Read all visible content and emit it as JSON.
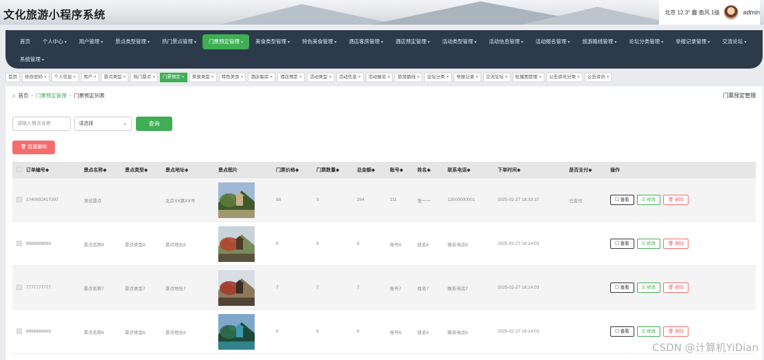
{
  "app": {
    "title": "文化旅游小程序系统"
  },
  "header": {
    "weather": "北京  12.3°  霾  南风  1级",
    "username": "admin"
  },
  "nav": {
    "items": [
      {
        "label": "首页",
        "has_caret": false
      },
      {
        "label": "个人中心",
        "has_caret": true
      },
      {
        "label": "用户管理",
        "has_caret": true
      },
      {
        "label": "景点类型管理",
        "has_caret": true
      },
      {
        "label": "热门景点管理",
        "has_caret": true
      },
      {
        "label": "门票预定管理",
        "has_caret": true,
        "active": true
      },
      {
        "label": "美食类型管理",
        "has_caret": true
      },
      {
        "label": "特色美食管理",
        "has_caret": true
      },
      {
        "label": "酒店客房管理",
        "has_caret": true
      },
      {
        "label": "酒店预定管理",
        "has_caret": true
      },
      {
        "label": "活动类型管理",
        "has_caret": true
      },
      {
        "label": "活动信息管理",
        "has_caret": true
      },
      {
        "label": "活动报名管理",
        "has_caret": true
      },
      {
        "label": "旅游路线管理",
        "has_caret": true
      },
      {
        "label": "论坛分类管理",
        "has_caret": true
      },
      {
        "label": "举报记录管理",
        "has_caret": true
      },
      {
        "label": "交流论坛",
        "has_caret": true
      },
      {
        "label": "系统管理",
        "has_caret": true
      }
    ],
    "caret": "▾"
  },
  "tags": [
    {
      "label": "首页",
      "closable": false
    },
    {
      "label": "修改密码",
      "closable": true
    },
    {
      "label": "个人信息",
      "closable": true
    },
    {
      "label": "用户",
      "closable": true
    },
    {
      "label": "景点类型",
      "closable": true
    },
    {
      "label": "热门景点",
      "closable": true
    },
    {
      "label": "门票预定",
      "closable": true,
      "active": true
    },
    {
      "label": "美食类型",
      "closable": true
    },
    {
      "label": "特色美食",
      "closable": true
    },
    {
      "label": "酒店客房",
      "closable": true
    },
    {
      "label": "酒店预定",
      "closable": true
    },
    {
      "label": "活动类型",
      "closable": true
    },
    {
      "label": "活动信息",
      "closable": true
    },
    {
      "label": "活动报名",
      "closable": true
    },
    {
      "label": "旅游路线",
      "closable": true
    },
    {
      "label": "论坛分类",
      "closable": true
    },
    {
      "label": "举报记录",
      "closable": true
    },
    {
      "label": "交流论坛",
      "closable": true
    },
    {
      "label": "轮播图管理",
      "closable": true
    },
    {
      "label": "公告资讯分类",
      "closable": true
    },
    {
      "label": "公告资讯",
      "closable": true
    }
  ],
  "breadcrumb": {
    "home": "首页",
    "sep": "-",
    "module": "门票预定管理",
    "current": "门票预定列表"
  },
  "page_label": "门票预定管理",
  "search": {
    "placeholder": "请输入景点名称",
    "select_value": "请选择",
    "query_label": "查询",
    "batch_delete_label": "批量删除"
  },
  "table": {
    "headers": [
      "订单编号",
      "景点名称",
      "景点类型",
      "景点地址",
      "景点图片",
      "门票价格",
      "门票数量",
      "总金额",
      "账号",
      "姓名",
      "联系电话",
      "下单时间",
      "是否支付",
      "操作"
    ],
    "sort_mark": "◆",
    "actions": {
      "view": "查看",
      "edit": "修改",
      "delete": "删除"
    },
    "rows": [
      {
        "order_no": "1740652417397",
        "name": "测试景点",
        "type": "",
        "address": "北京XX路XX号",
        "price": "88",
        "qty": "3",
        "total": "264",
        "account": "111",
        "person": "张一一",
        "phone": "13500000001",
        "time": "2025-02-27 18:33:37",
        "paid": "已支付",
        "img": "scene-1"
      },
      {
        "order_no": "8888888888",
        "name": "景点名称8",
        "type": "景点类型8",
        "address": "景点地址8",
        "price": "8",
        "qty": "8",
        "total": "8",
        "account": "账号8",
        "person": "姓名8",
        "phone": "联系电话8",
        "time": "2025-02-27 16:14:03",
        "paid": "",
        "img": "scene-2"
      },
      {
        "order_no": "7777777777",
        "name": "景点名称7",
        "type": "景点类型7",
        "address": "景点地址7",
        "price": "7",
        "qty": "7",
        "total": "7",
        "account": "账号7",
        "person": "姓名7",
        "phone": "联系电话7",
        "time": "2025-02-27 16:14:03",
        "paid": "",
        "img": "scene-3"
      },
      {
        "order_no": "6666666666",
        "name": "景点名称6",
        "type": "景点类型6",
        "address": "景点地址6",
        "price": "6",
        "qty": "6",
        "total": "6",
        "account": "账号6",
        "person": "姓名6",
        "phone": "联系电话6",
        "time": "2025-02-27 16:14:03",
        "paid": "",
        "img": "scene-4"
      }
    ]
  },
  "watermark": "CSDN @计算机YiDian",
  "colors": {
    "accent": "#3fae55",
    "danger": "#f56c6c",
    "nav_bg": "#2c3a4a"
  }
}
